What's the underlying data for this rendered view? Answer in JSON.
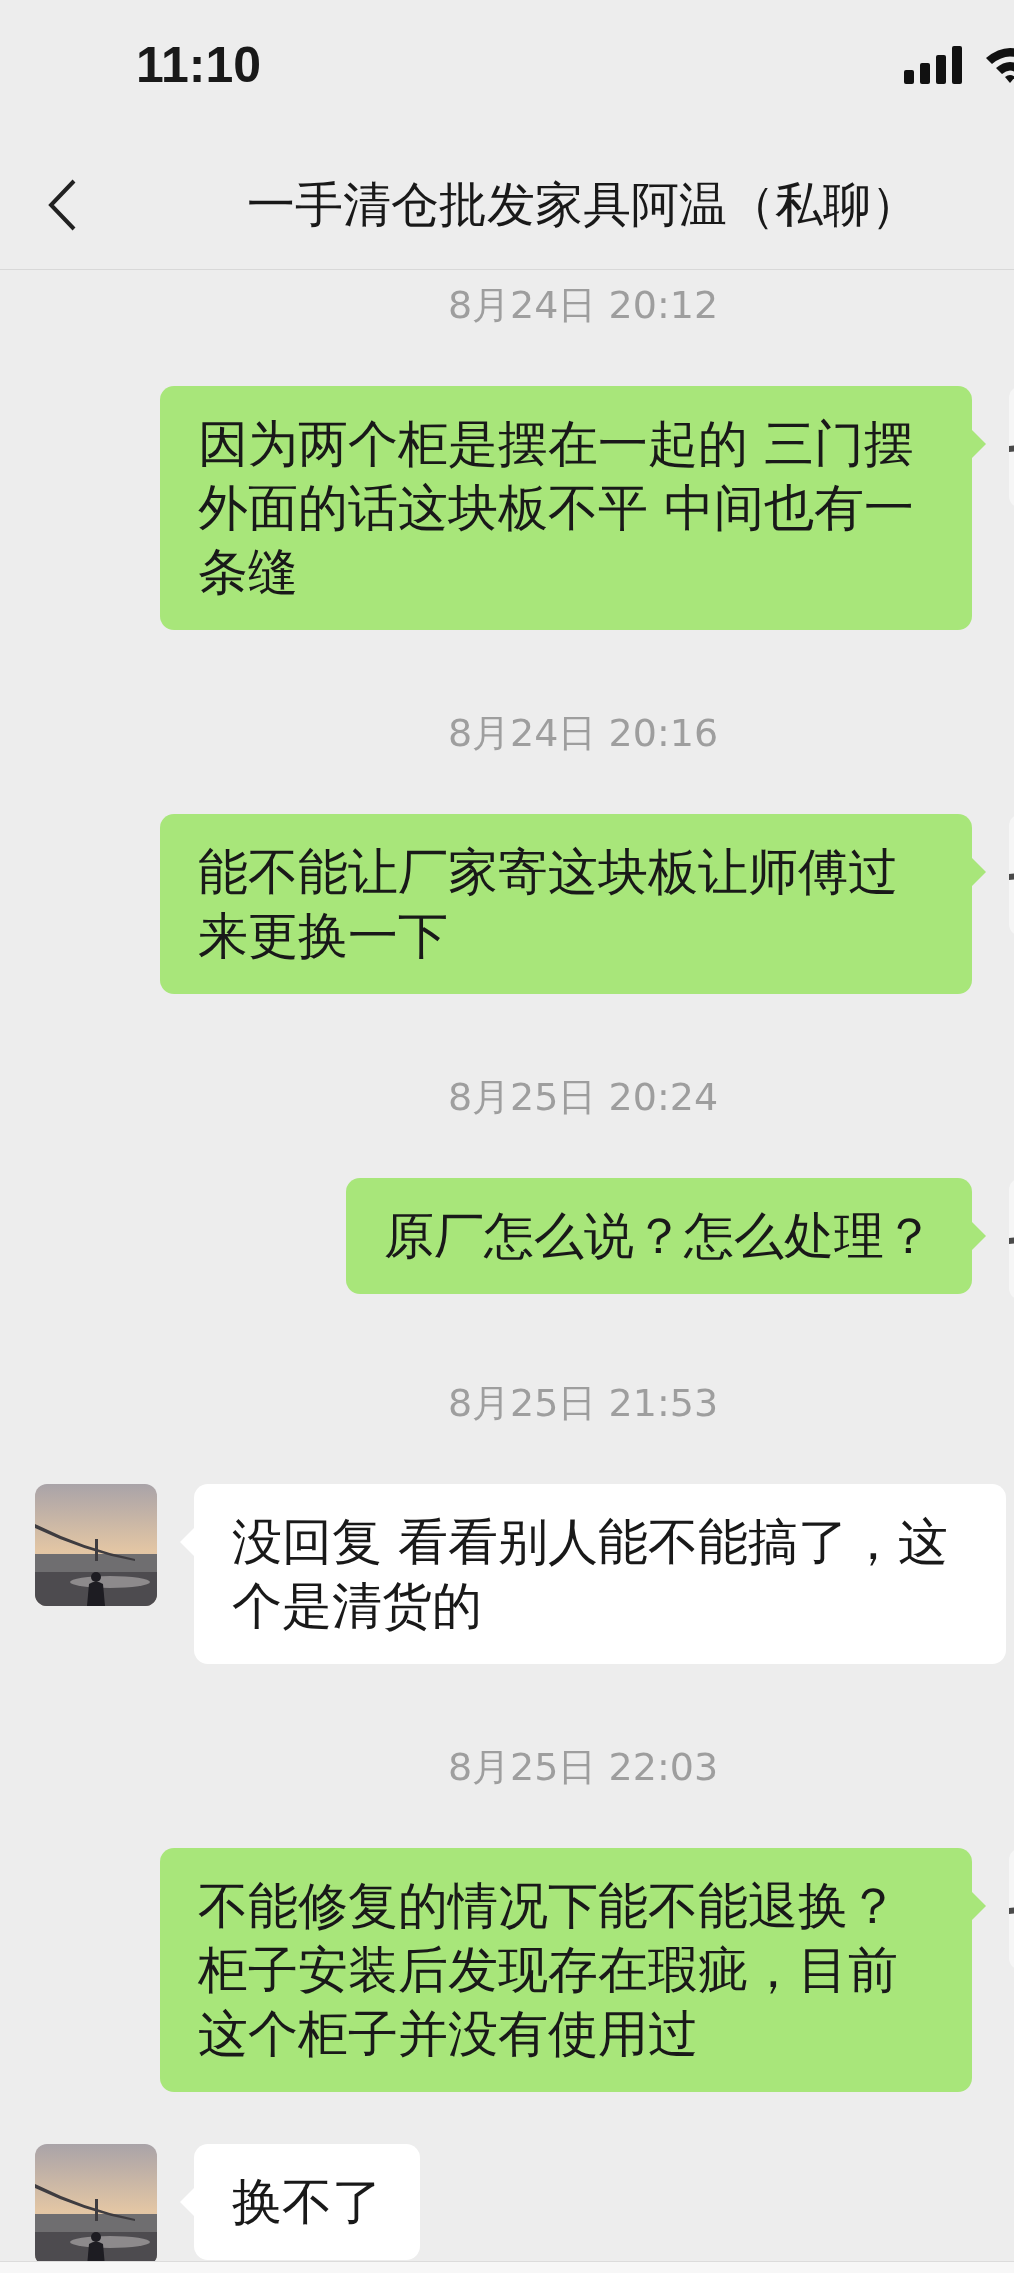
{
  "status_bar": {
    "time": "11:10"
  },
  "header": {
    "title": "一手清仓批发家具阿温（私聊）"
  },
  "messages": [
    {
      "kind": "timestamp",
      "text": "8月24日 20:12"
    },
    {
      "kind": "sent",
      "text": "因为两个柜是摆在一起的 三门摆外面的话这块板不平 中间也有一条缝"
    },
    {
      "kind": "timestamp",
      "text": "8月24日 20:16"
    },
    {
      "kind": "sent",
      "text": "能不能让厂家寄这块板让师傅过来更换一下"
    },
    {
      "kind": "timestamp",
      "text": "8月25日 20:24"
    },
    {
      "kind": "sent",
      "text": "原厂怎么说？怎么处理？"
    },
    {
      "kind": "timestamp",
      "text": "8月25日 21:53"
    },
    {
      "kind": "received",
      "text": "没回复 看看别人能不能搞了，这个是清货的"
    },
    {
      "kind": "timestamp",
      "text": "8月25日 22:03"
    },
    {
      "kind": "sent",
      "text": "不能修复的情况下能不能退换？柜子安装后发现存在瑕疵，目前这个柜子并没有使用过"
    },
    {
      "kind": "received",
      "text": "换不了"
    }
  ]
}
